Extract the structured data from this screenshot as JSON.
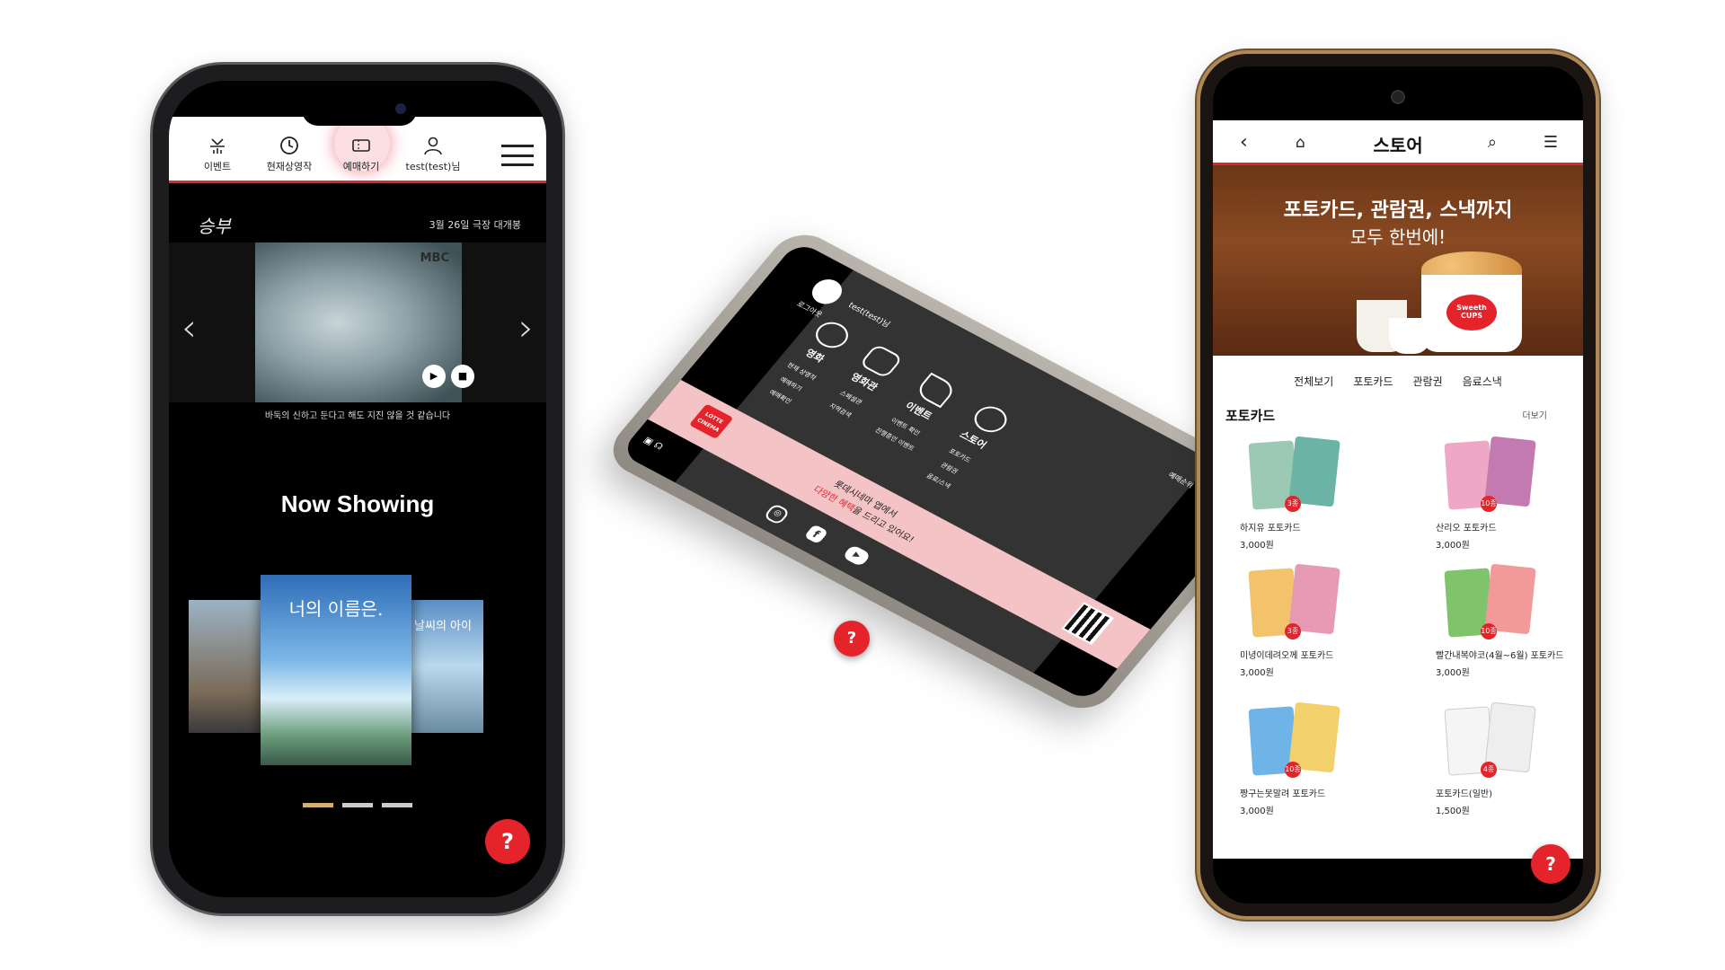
{
  "phone1": {
    "nav": [
      {
        "label": "이벤트",
        "icon": "event-icon"
      },
      {
        "label": "현재상영작",
        "icon": "clock-icon"
      },
      {
        "label": "예매하기",
        "icon": "ticket-icon",
        "active": true
      },
      {
        "label": "test(test)님",
        "icon": "user-icon"
      }
    ],
    "logo_text": "승부",
    "release_text": "3월 26일 극장 대개봉",
    "video_badge": "MBC",
    "caption": "바둑의 신하고 둔다고 해도 지진 않을 것 같습니다",
    "section_title": "Now Showing",
    "posters": [
      {
        "title": "",
        "colors": [
          "#6c8fa8",
          "#c9b8a0"
        ]
      },
      {
        "title": "너의 이름은.",
        "colors": [
          "#3a73c4",
          "#9fd3f0"
        ]
      },
      {
        "title": "날씨의 아이",
        "colors": [
          "#5e8fc0",
          "#cfe3ef"
        ]
      }
    ],
    "carousel_active": 0
  },
  "phone2": {
    "user_label": "test(test)님",
    "logout_label": "로그아웃",
    "ranking_label": "예매순위",
    "columns": [
      {
        "title": "영화",
        "icon": "film-reel-icon",
        "items": [
          "현재 상영작",
          "예매하기",
          "예매확인"
        ]
      },
      {
        "title": "영화관",
        "icon": "theater-icon",
        "items": [
          "스페셜관",
          "지역검색"
        ]
      },
      {
        "title": "이벤트",
        "icon": "party-popper-icon",
        "items": [
          "이벤트 확인",
          "진행중인 이벤트"
        ]
      },
      {
        "title": "스토어",
        "icon": "popcorn-icon",
        "items": [
          "포토카드",
          "관람권",
          "음료/스낵"
        ]
      }
    ],
    "banner": {
      "logo": "LOTTE CINEMA",
      "line1": "롯데시네마 앱에서",
      "line2_highlight": "다양한 혜택",
      "line2_rest": "을 드리고 있어요!"
    },
    "social": [
      "instagram-icon",
      "facebook-icon",
      "youtube-icon"
    ]
  },
  "phone3": {
    "title": "스토어",
    "hero_line1": "포토카드, 관람권, 스낵까지",
    "hero_line2": "모두 한번에!",
    "hero_brand": "Sweeth CUPS",
    "categories": [
      "전체보기",
      "포토카드",
      "관람권",
      "음료스낵"
    ],
    "section_title": "포토카드",
    "more_label": "더보기",
    "products": [
      {
        "name": "하지유 포토카드",
        "price": "3,000원",
        "badge": "3종",
        "colors": [
          "#9cc9b4",
          "#6bb3a6"
        ]
      },
      {
        "name": "산리오 포토카드",
        "price": "3,000원",
        "badge": "10종",
        "colors": [
          "#f0a7c5",
          "#c27ab0"
        ]
      },
      {
        "name": "미녕이데려오께 포토카드",
        "price": "3,000원",
        "badge": "3종",
        "colors": [
          "#f2c36b",
          "#e69ab4"
        ]
      },
      {
        "name": "빨간내복야코(4월~6월) 포토카드",
        "price": "3,000원",
        "badge": "10종",
        "colors": [
          "#7fc36b",
          "#f29a9a"
        ]
      },
      {
        "name": "짱구는못말려 포토카드",
        "price": "3,000원",
        "badge": "10종",
        "colors": [
          "#6fb4e6",
          "#f2d06b"
        ]
      },
      {
        "name": "포토카드(일반)",
        "price": "1,500원",
        "badge": "4종",
        "colors": [
          "#f5f5f5",
          "#eeeeee"
        ]
      }
    ]
  },
  "colors": {
    "accent": "#e4232a",
    "pink": "#f4c3c6",
    "dark": "#333333"
  }
}
